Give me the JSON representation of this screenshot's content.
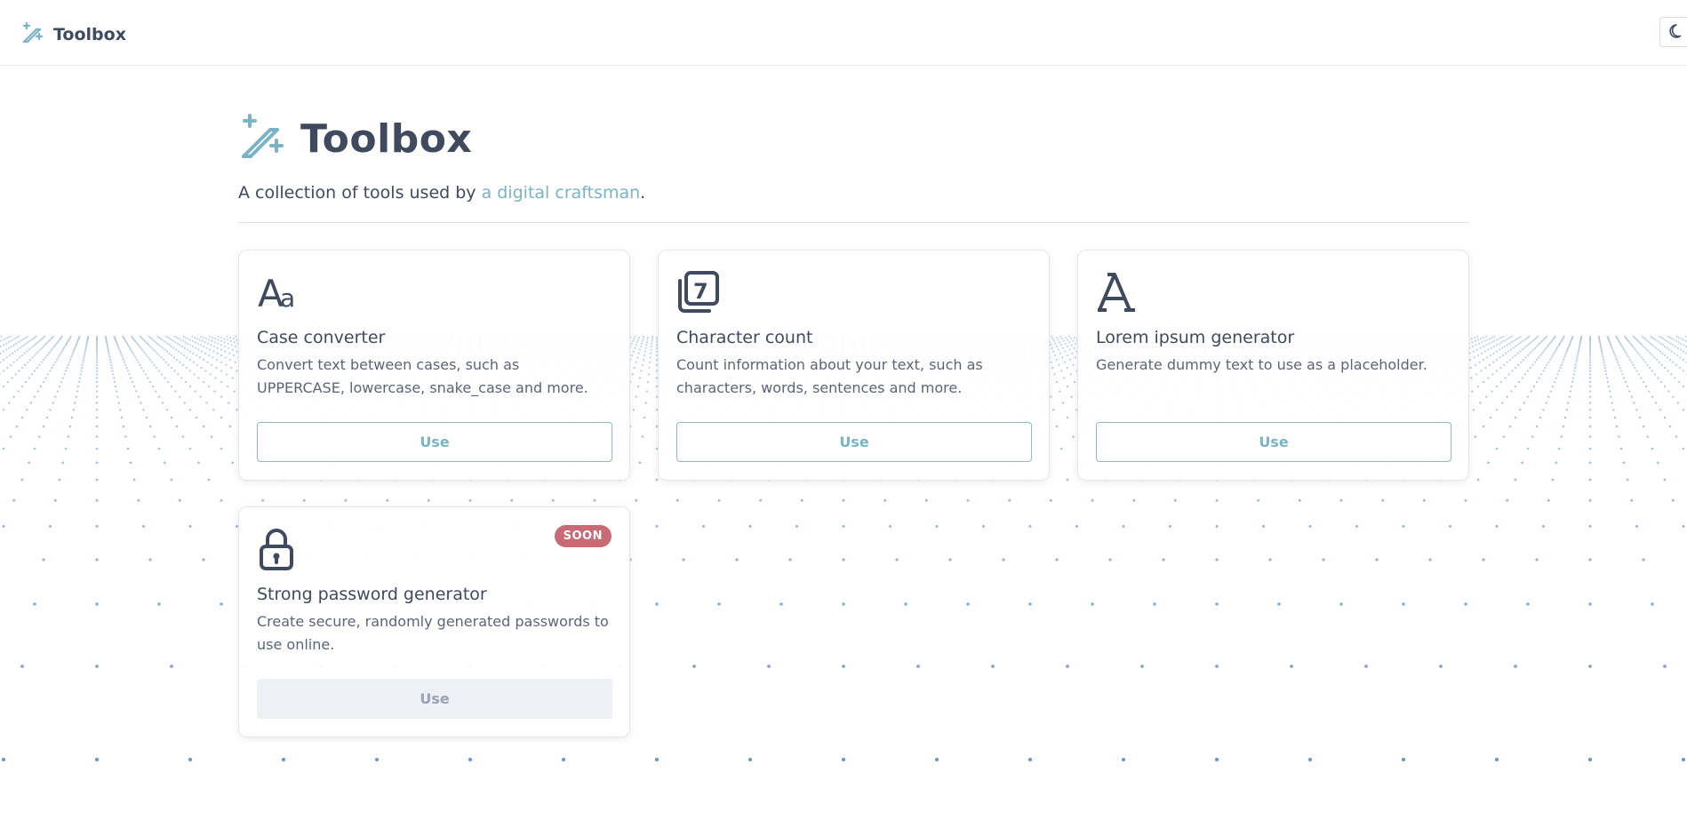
{
  "header": {
    "brand_name": "Toolbox",
    "brand_icon": "wand-sparkles-icon",
    "theme_toggle_icon": "moon-icon"
  },
  "hero": {
    "title": "Toolbox",
    "icon": "wand-sparkles-icon",
    "tagline_prefix": "A collection of tools used by ",
    "tagline_link": "a digital craftsman",
    "tagline_suffix": "."
  },
  "tools": [
    {
      "icon": "case-letters-icon",
      "title": "Case converter",
      "description": "Convert text between cases, such as UPPERCASE, lowercase, snake_case and more.",
      "button_label": "Use",
      "disabled": false
    },
    {
      "icon": "number-seven-stack-icon",
      "title": "Character count",
      "description": "Count information about your text, such as characters, words, sentences and more.",
      "button_label": "Use",
      "disabled": false
    },
    {
      "icon": "letter-a-icon",
      "title": "Lorem ipsum generator",
      "description": "Generate dummy text to use as a placeholder.",
      "button_label": "Use",
      "disabled": false
    },
    {
      "icon": "lock-icon",
      "title": "Strong password generator",
      "description": "Create secure, randomly generated passwords to use online.",
      "button_label": "Use",
      "disabled": true,
      "badge": "SOON"
    }
  ],
  "colors": {
    "accent": "#7bb3c6",
    "text_dark": "#3f4a5e",
    "badge": "#c96a74",
    "dots": "#5f86b8"
  }
}
